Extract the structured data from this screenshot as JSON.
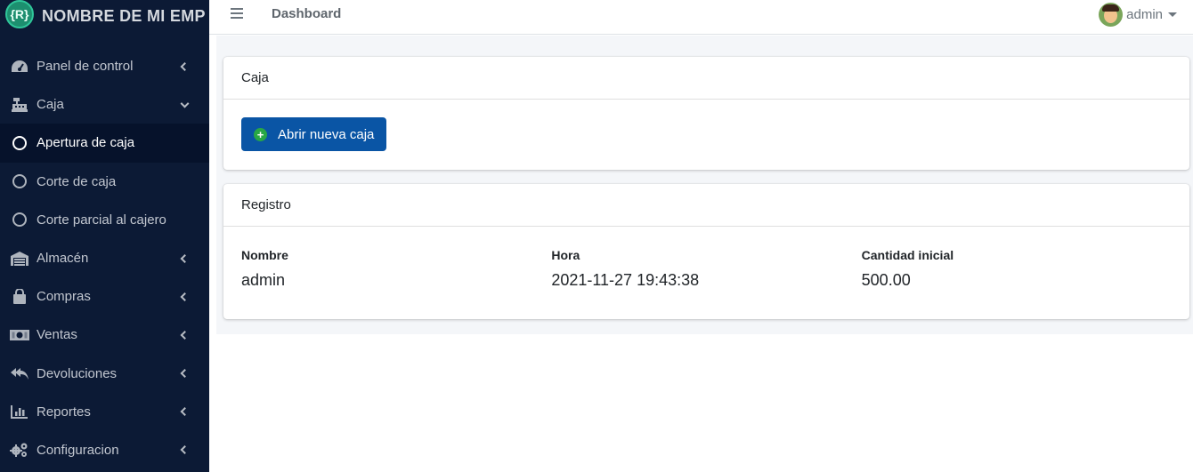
{
  "brand": {
    "logo_text": "{R}",
    "name": "NOMBRE DE MI EMP"
  },
  "sidebar": {
    "items": [
      {
        "label": "Panel de control",
        "icon": "tachometer-icon"
      },
      {
        "label": "Caja",
        "icon": "cash-register-icon"
      },
      {
        "label": "Apertura de caja",
        "icon": "circle-icon"
      },
      {
        "label": "Corte de caja",
        "icon": "circle-icon"
      },
      {
        "label": "Corte parcial al cajero",
        "icon": "circle-icon"
      },
      {
        "label": "Almacén",
        "icon": "warehouse-icon"
      },
      {
        "label": "Compras",
        "icon": "shopping-bag-icon"
      },
      {
        "label": "Ventas",
        "icon": "money-bill-icon"
      },
      {
        "label": "Devoluciones",
        "icon": "reply-all-icon"
      },
      {
        "label": "Reportes",
        "icon": "chart-bar-icon"
      },
      {
        "label": "Configuracion",
        "icon": "cogs-icon"
      }
    ]
  },
  "topbar": {
    "title": "Dashboard",
    "user": "admin"
  },
  "caja_card": {
    "title": "Caja",
    "button_label": "Abrir nueva caja"
  },
  "registro_card": {
    "title": "Registro",
    "headers": [
      "Nombre",
      "Hora",
      "Cantidad inicial"
    ],
    "values": [
      "admin",
      "2021-11-27 19:43:38",
      "500.00"
    ]
  },
  "colors": {
    "sidebar_bg": "#0c1a35",
    "active_item_bg": "#06122b",
    "primary_button": "#0a55a5",
    "plus_icon": "#28a745",
    "content_bg": "#f4f6f9"
  }
}
